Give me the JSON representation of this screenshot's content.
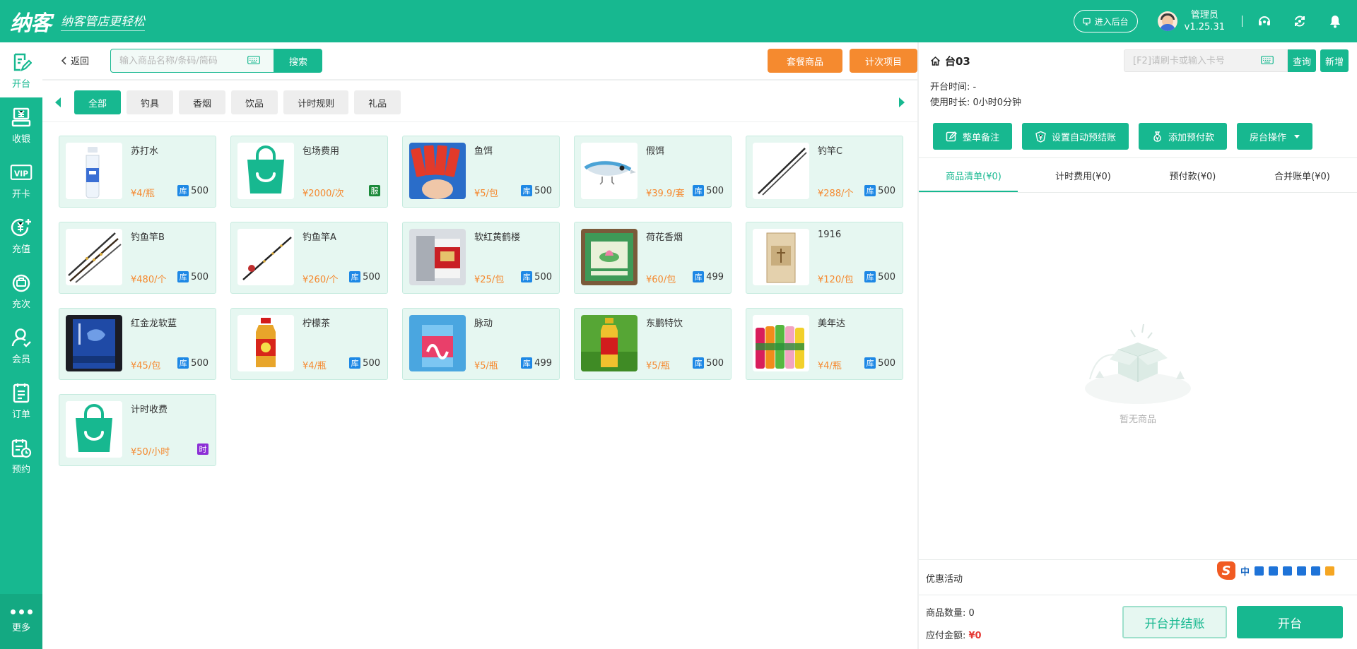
{
  "brand": {
    "logo": "纳客",
    "slogan": "纳客管店更轻松"
  },
  "header": {
    "backend_label": "进入后台",
    "user_name": "管理员",
    "version": "v1.25.31",
    "icons": [
      "headset-icon",
      "sync-icon",
      "bell-icon"
    ]
  },
  "sidebar": {
    "items": [
      {
        "label": "开台",
        "icon": "open-table-icon",
        "active": true
      },
      {
        "label": "收银",
        "icon": "cashier-icon"
      },
      {
        "label": "开卡",
        "icon": "vip-card-icon"
      },
      {
        "label": "充值",
        "icon": "recharge-icon"
      },
      {
        "label": "充次",
        "icon": "recharge-times-icon"
      },
      {
        "label": "会员",
        "icon": "member-icon"
      },
      {
        "label": "订单",
        "icon": "order-icon"
      },
      {
        "label": "预约",
        "icon": "reservation-icon"
      }
    ],
    "more_label": "更多"
  },
  "toolbar": {
    "back_label": "返回",
    "search_placeholder": "输入商品名称/条码/简码",
    "search_label": "搜索",
    "package_label": "套餐商品",
    "count_label": "计次项目"
  },
  "categories": [
    "全部",
    "钓具",
    "香烟",
    "饮品",
    "计时规则",
    "礼品"
  ],
  "products": [
    {
      "name": "苏打水",
      "price": "¥4/瓶",
      "badge": "库",
      "badge_color": "#1e88e5",
      "stock": "500",
      "img": "bottle"
    },
    {
      "name": "包场费用",
      "price": "¥2000/次",
      "badge": "服",
      "badge_color": "#1b8a3a",
      "stock": "",
      "img": "bag"
    },
    {
      "name": "鱼饵",
      "price": "¥5/包",
      "badge": "库",
      "badge_color": "#1e88e5",
      "stock": "500",
      "img": "bait"
    },
    {
      "name": "假饵",
      "price": "¥39.9/套",
      "badge": "库",
      "badge_color": "#1e88e5",
      "stock": "500",
      "img": "lure"
    },
    {
      "name": "钓竿C",
      "price": "¥288/个",
      "badge": "库",
      "badge_color": "#1e88e5",
      "stock": "500",
      "img": "rod"
    },
    {
      "name": "钓鱼竿B",
      "price": "¥480/个",
      "badge": "库",
      "badge_color": "#1e88e5",
      "stock": "500",
      "img": "rods"
    },
    {
      "name": "钓鱼竿A",
      "price": "¥260/个",
      "badge": "库",
      "badge_color": "#1e88e5",
      "stock": "500",
      "img": "rodreel"
    },
    {
      "name": "软红黄鹤楼",
      "price": "¥25/包",
      "badge": "库",
      "badge_color": "#1e88e5",
      "stock": "500",
      "img": "cig-red"
    },
    {
      "name": "荷花香烟",
      "price": "¥60/包",
      "badge": "库",
      "badge_color": "#1e88e5",
      "stock": "499",
      "img": "cig-lotus"
    },
    {
      "name": "1916",
      "price": "¥120/包",
      "badge": "库",
      "badge_color": "#1e88e5",
      "stock": "500",
      "img": "cig-1916"
    },
    {
      "name": "红金龙软蓝",
      "price": "¥45/包",
      "badge": "库",
      "badge_color": "#1e88e5",
      "stock": "500",
      "img": "cig-blue"
    },
    {
      "name": "柠檬茶",
      "price": "¥4/瓶",
      "badge": "库",
      "badge_color": "#1e88e5",
      "stock": "500",
      "img": "tea"
    },
    {
      "name": "脉动",
      "price": "¥5/瓶",
      "badge": "库",
      "badge_color": "#1e88e5",
      "stock": "499",
      "img": "mizone"
    },
    {
      "name": "东鹏特饮",
      "price": "¥5/瓶",
      "badge": "库",
      "badge_color": "#1e88e5",
      "stock": "500",
      "img": "energy"
    },
    {
      "name": "美年达",
      "price": "¥4/瓶",
      "badge": "库",
      "badge_color": "#1e88e5",
      "stock": "500",
      "img": "mirinda"
    },
    {
      "name": "计时收费",
      "price": "¥50/小时",
      "badge": "时",
      "badge_color": "#8c2fd6",
      "stock": "",
      "img": "bag"
    }
  ],
  "panel": {
    "table_name": "台03",
    "card_placeholder": "[F2]请刷卡或输入卡号",
    "query_label": "查询",
    "add_label": "新增",
    "open_time": "开台时间: -",
    "duration": "使用时长: 0小时0分钟",
    "actions": [
      "整单备注",
      "设置自动预结账",
      "添加预付款",
      "房台操作"
    ],
    "tabs": [
      "商品清单(¥0)",
      "计时费用(¥0)",
      "预付款(¥0)",
      "合并账单(¥0)"
    ],
    "empty_text": "暂无商品",
    "promo_label": "优惠活动",
    "qty_text": "商品数量: 0",
    "amount_label": "应付金额: ",
    "amount_value": "¥0",
    "settle_label": "开台并结账",
    "open_label": "开台"
  },
  "ime": {
    "logo": "S",
    "lang": "中"
  },
  "colors": {
    "primary": "#17b890",
    "accent": "#f58a2f",
    "price": "#f5892f",
    "danger": "#e53935"
  }
}
